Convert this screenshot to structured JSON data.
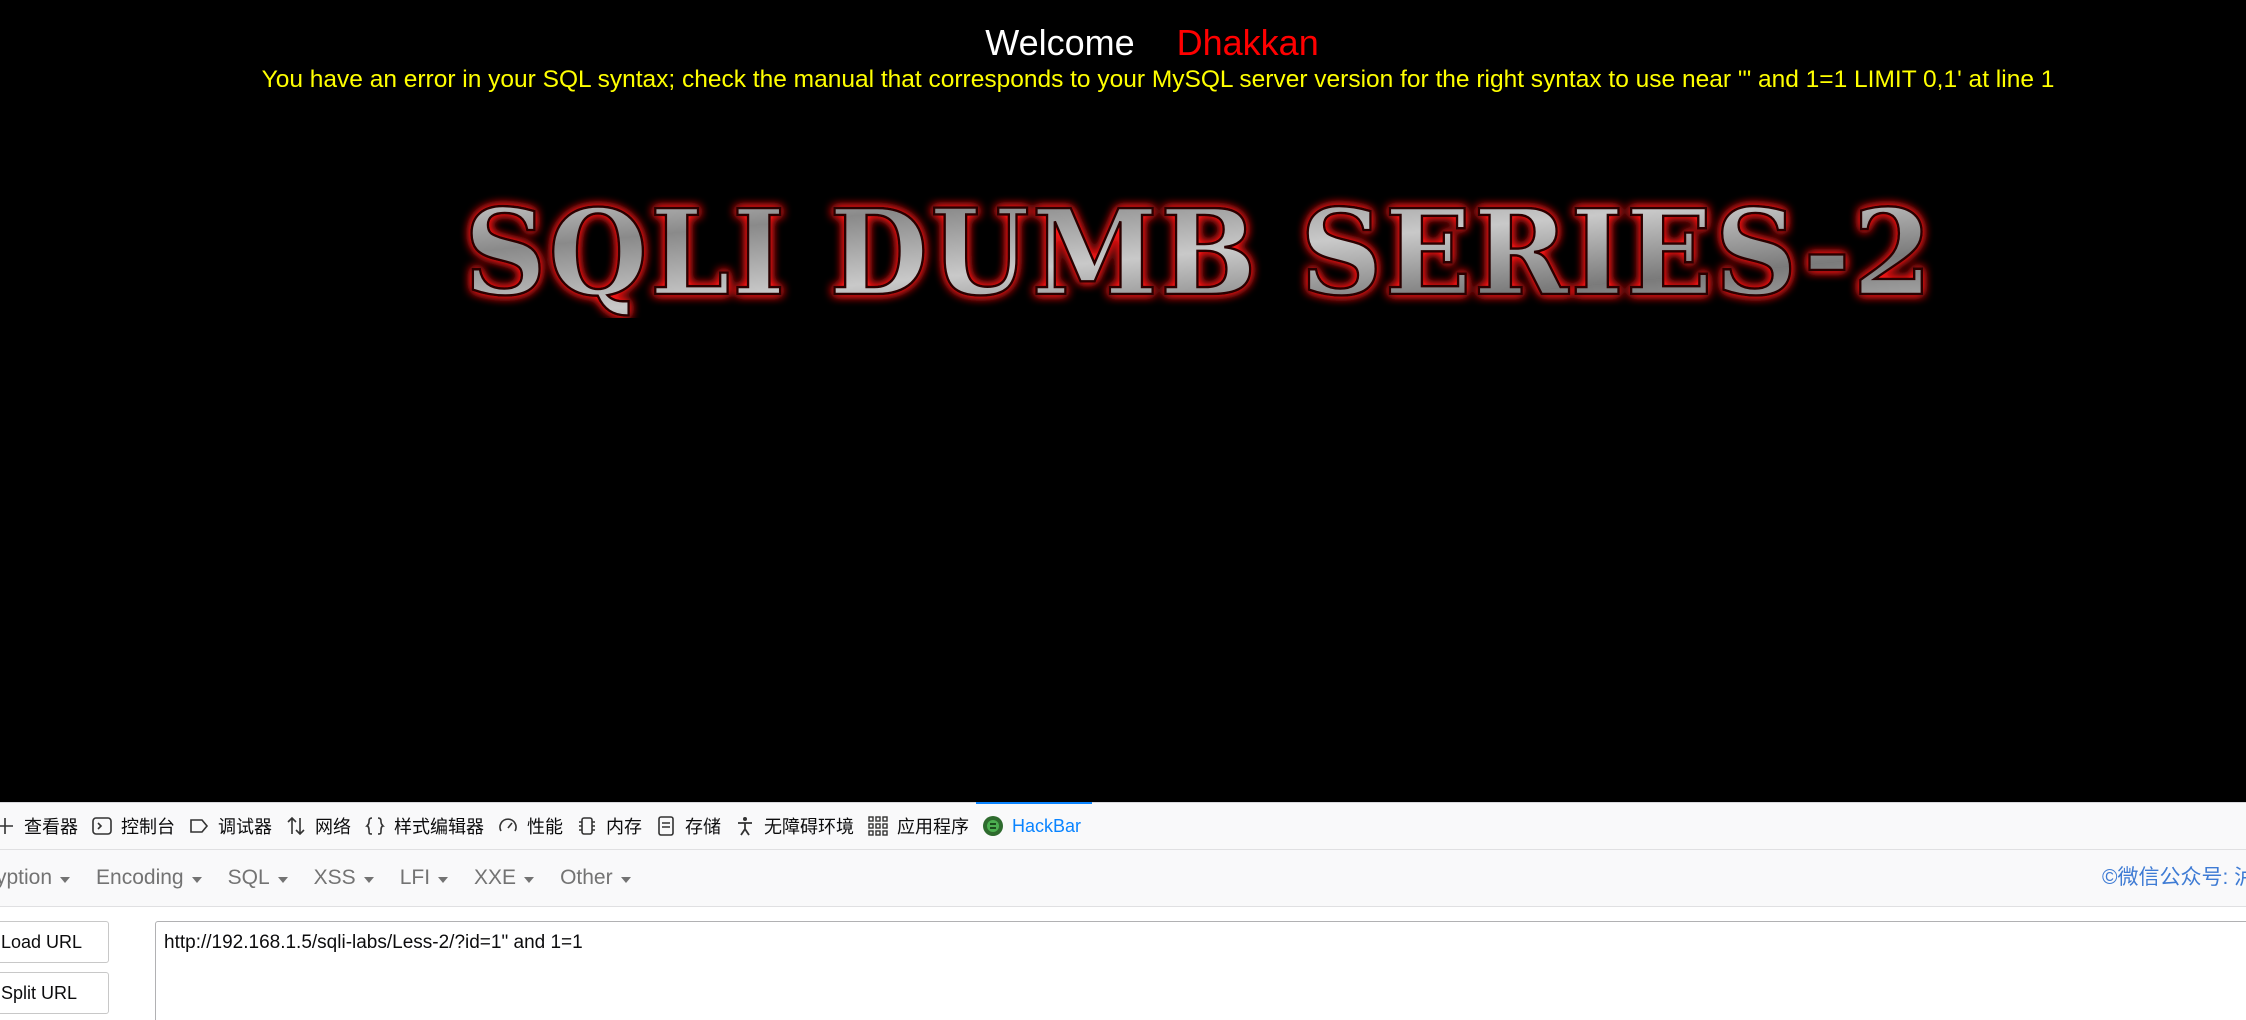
{
  "page": {
    "welcome": "Welcome",
    "user_name": "Dhakkan",
    "error_message": "You have an error in your SQL syntax; check the manual that corresponds to your MySQL server version for the right syntax to use near '\" and 1=1 LIMIT 0,1' at line 1",
    "banner_text": "SQLI DUMB SERIES-2"
  },
  "devtools": {
    "tabs": [
      {
        "label": "查看器",
        "icon": "inspector-icon"
      },
      {
        "label": "控制台",
        "icon": "console-icon"
      },
      {
        "label": "调试器",
        "icon": "debugger-icon"
      },
      {
        "label": "网络",
        "icon": "network-icon"
      },
      {
        "label": "样式编辑器",
        "icon": "style-editor-icon"
      },
      {
        "label": "性能",
        "icon": "performance-icon"
      },
      {
        "label": "内存",
        "icon": "memory-icon"
      },
      {
        "label": "存储",
        "icon": "storage-icon"
      },
      {
        "label": "无障碍环境",
        "icon": "accessibility-icon"
      },
      {
        "label": "应用程序",
        "icon": "application-icon"
      },
      {
        "label": "HackBar",
        "icon": "hackbar-icon",
        "active": true
      }
    ],
    "active_color": "#0a84ff"
  },
  "hackbar": {
    "menus": [
      "yption",
      "Encoding",
      "SQL",
      "XSS",
      "LFI",
      "XXE",
      "Other"
    ],
    "watermark": "©微信公众号: 泸",
    "load_url_label": "Load URL",
    "split_url_label": "Split URL",
    "url_value": "http://192.168.1.5/sqli-labs/Less-2/?id=1\" and 1=1"
  }
}
